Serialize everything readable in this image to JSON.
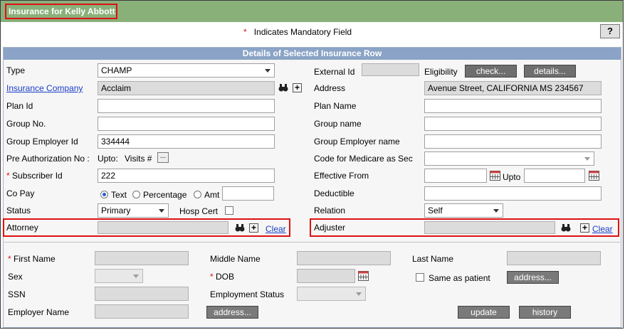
{
  "header": {
    "title": "Insurance for Kelly Abbott"
  },
  "mandatory_note": "Indicates Mandatory Field",
  "mandatory_star": "*",
  "help_label": "?",
  "panel_title": "Details of Selected Insurance Row",
  "left": {
    "type_label": "Type",
    "type_value": "CHAMP",
    "ins_company_label": "Insurance Company",
    "ins_company_value": "Acclaim",
    "plan_id_label": "Plan Id",
    "group_no_label": "Group No.",
    "group_emp_id_label": "Group Employer Id",
    "group_emp_id_value": "334444",
    "preauth_label": "Pre Authorization No :",
    "upto_label": "Upto:",
    "visits_label": "Visits #",
    "ellipsis_label": "...",
    "subscriber_label": "Subscriber Id",
    "subscriber_value": "222",
    "copay_label": "Co Pay",
    "copay_text": "Text",
    "copay_pct": "Percentage",
    "copay_amt": "Amt",
    "status_label": "Status",
    "status_value": "Primary",
    "hosp_cert_label": "Hosp Cert",
    "attorney_label": "Attorney",
    "clear_label": "Clear"
  },
  "right": {
    "external_id_label": "External Id",
    "eligibility_label": "Eligibility",
    "check_label": "check...",
    "details_label": "details...",
    "address_label": "Address",
    "address_value": "Avenue Street, CALIFORNIA MS 234567",
    "plan_name_label": "Plan Name",
    "group_name_label": "Group name",
    "group_emp_name_label": "Group Employer name",
    "medicare_label": "Code for Medicare as Sec",
    "effective_label": "Effective From",
    "upto_label": "Upto",
    "deductible_label": "Deductible",
    "relation_label": "Relation",
    "relation_value": "Self",
    "adjuster_label": "Adjuster",
    "clear_label": "Clear"
  },
  "subscriber": {
    "first_name_label": "First Name",
    "middle_name_label": "Middle Name",
    "last_name_label": "Last Name",
    "sex_label": "Sex",
    "dob_label": "DOB",
    "same_as_patient_label": "Same as patient",
    "address_btn": "address...",
    "ssn_label": "SSN",
    "employment_label": "Employment Status",
    "employer_label": "Employer Name",
    "employer_address_btn": "address...",
    "update_btn": "update",
    "history_btn": "history"
  }
}
